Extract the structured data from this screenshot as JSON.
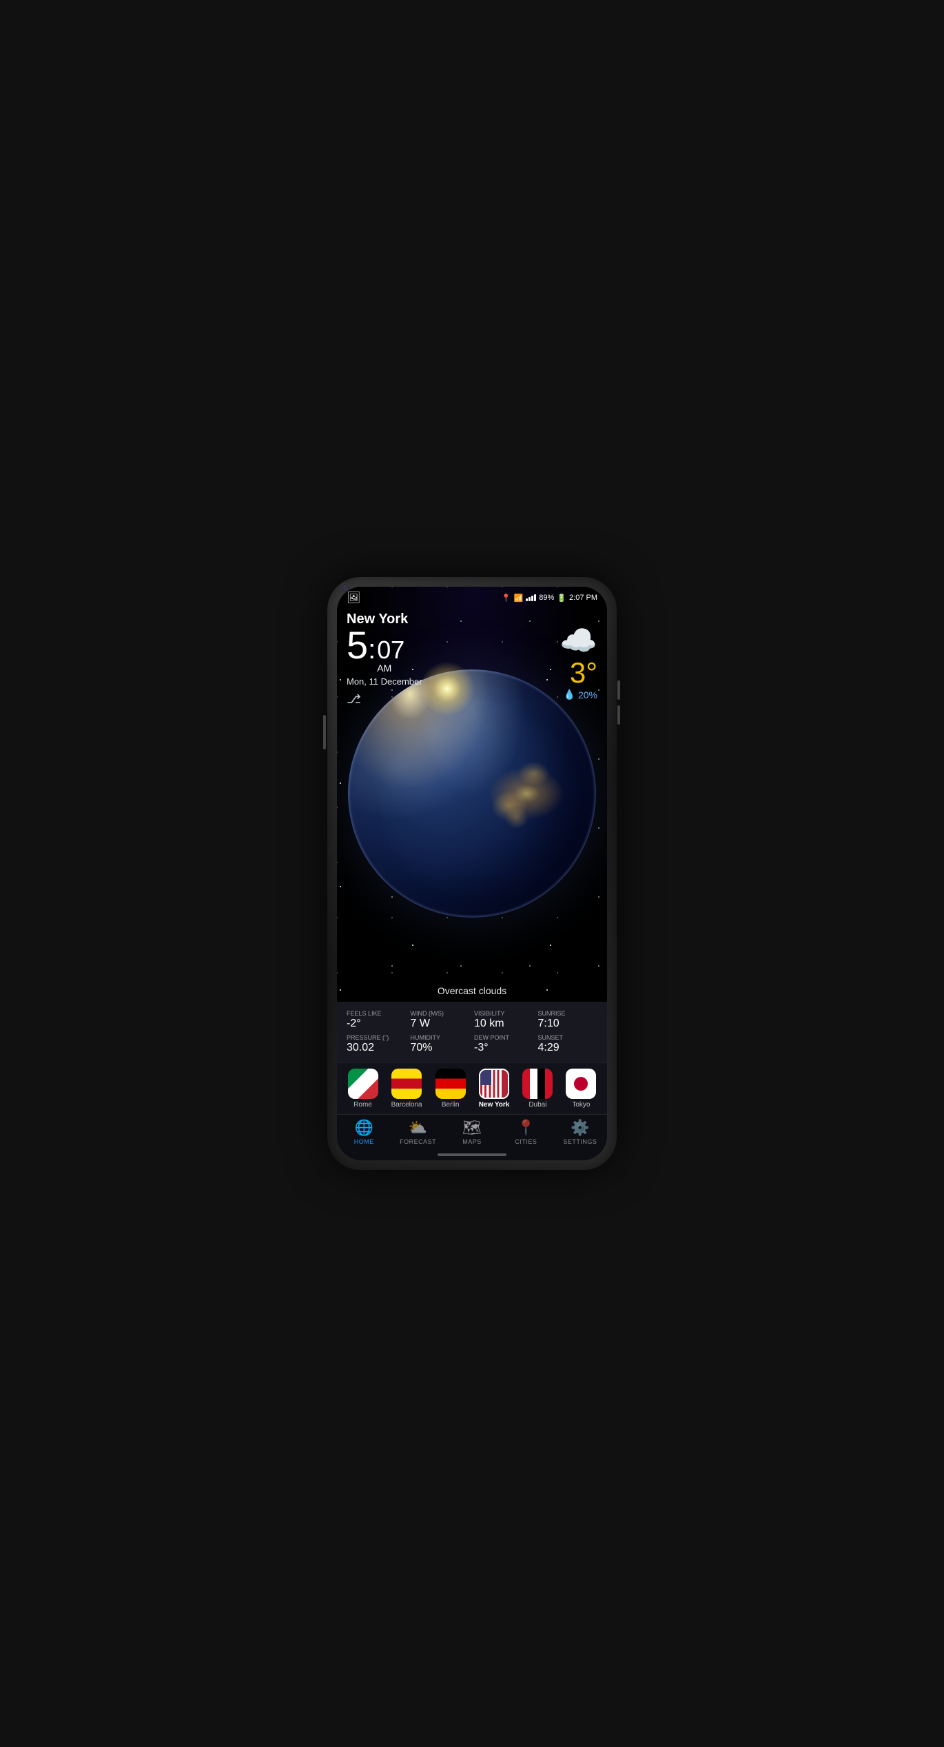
{
  "phone": {
    "statusBar": {
      "battery": "89%",
      "time": "2:07 PM",
      "signal": 4,
      "wifi": true,
      "location": true
    },
    "weather": {
      "cityName": "New York",
      "timeHour": "5",
      "timeMin": "07",
      "timeAmPm": "AM",
      "date": "Mon, 11 December",
      "temperature": "3°",
      "temperatureColor": "#f0c000",
      "rainChance": "20%",
      "condition": "Overcast clouds",
      "feelsLike": "-2°",
      "wind": "7 W",
      "visibility": "10 km",
      "sunrise": "7:10",
      "pressure": "30.02",
      "humidity": "70%",
      "dewPoint": "-3°",
      "sunset": "4:29",
      "feelsLikeLabel": "Feels like",
      "windLabel": "Wind (m/s)",
      "visibilityLabel": "Visibility",
      "sunriseLabel": "Sunrise",
      "pressureLabel": "Pressure (\")",
      "humidityLabel": "Humidity",
      "dewPointLabel": "Dew Point",
      "sunsetLabel": "Sunset"
    },
    "cities": [
      {
        "name": "Rome",
        "flag": "rome",
        "active": false
      },
      {
        "name": "Barcelona",
        "flag": "barcelona",
        "active": false
      },
      {
        "name": "Berlin",
        "flag": "berlin",
        "active": false
      },
      {
        "name": "New York",
        "flag": "ny",
        "active": true
      },
      {
        "name": "Dubai",
        "flag": "dubai",
        "active": false
      },
      {
        "name": "Tokyo",
        "flag": "tokyo",
        "active": false
      }
    ],
    "nav": [
      {
        "id": "home",
        "label": "HOME",
        "active": true
      },
      {
        "id": "forecast",
        "label": "FORECAST",
        "active": false
      },
      {
        "id": "maps",
        "label": "MAPS",
        "active": false
      },
      {
        "id": "cities",
        "label": "CITIES",
        "active": false
      },
      {
        "id": "settings",
        "label": "SETTINGS",
        "active": false
      }
    ]
  }
}
